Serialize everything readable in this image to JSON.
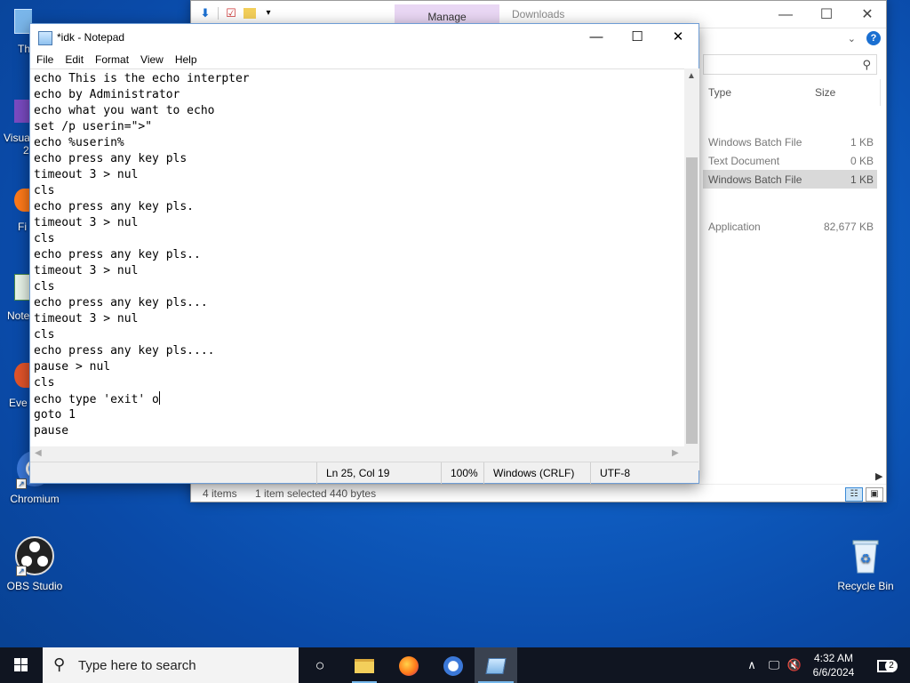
{
  "desktop": {
    "icons": [
      {
        "label": "This PC (partial)",
        "visible_label": "Th"
      },
      {
        "label": "Visual Studio (partial)",
        "visible_label": "Visua"
      },
      {
        "label": "Firefox (partial)",
        "visible_label": "Fi"
      },
      {
        "label": "Notepad (partial)",
        "visible_label": "Note"
      },
      {
        "label": "Everything (partial)",
        "visible_label": "Eve"
      },
      {
        "label": "Chromium",
        "visible_label": "Chromium"
      },
      {
        "label": "OBS Studio",
        "visible_label": "OBS Studio"
      },
      {
        "label": "Recycle Bin",
        "visible_label": "Recycle Bin"
      }
    ],
    "partial_labels": {
      "this_pc": "Th",
      "visual": "Visua",
      "visual_suffix": "2",
      "firefox": "Fi",
      "notepad": "Note",
      "everything": "Eve"
    },
    "chromium_label": "Chromium",
    "obs_label": "OBS Studio",
    "recycle_label": "Recycle Bin"
  },
  "explorer": {
    "ribbon_tab_manage": "Manage",
    "title": "Downloads",
    "help": "?",
    "columns": {
      "type": "Type",
      "size": "Size"
    },
    "rows": [
      {
        "type": "Windows Batch File",
        "size": "1 KB",
        "selected": false
      },
      {
        "type": "Text Document",
        "size": "0 KB",
        "selected": false
      },
      {
        "type": "Windows Batch File",
        "size": "1 KB",
        "selected": true
      },
      {
        "type": "Application",
        "size": "82,677 KB",
        "selected": false
      }
    ],
    "status": {
      "items": "4 items",
      "selected": "1 item selected  440 bytes"
    }
  },
  "notepad": {
    "title": "*idk - Notepad",
    "menu": [
      "File",
      "Edit",
      "Format",
      "View",
      "Help"
    ],
    "lines": [
      "echo This is the echo interpter",
      "echo by Administrator",
      "echo what you want to echo",
      "set /p userin=\">\"",
      "echo %userin%",
      "echo press any key pls",
      "timeout 3 > nul",
      "cls",
      "echo press any key pls.",
      "timeout 3 > nul",
      "cls",
      "echo press any key pls..",
      "timeout 3 > nul",
      "cls",
      "echo press any key pls...",
      "timeout 3 > nul",
      "cls",
      "echo press any key pls....",
      "pause > nul",
      "cls",
      "echo type 'exit' o",
      "goto 1",
      "pause"
    ],
    "caret_line_index": 20,
    "status": {
      "position": "Ln 25, Col 19",
      "zoom": "100%",
      "line_ending": "Windows (CRLF)",
      "encoding": "UTF-8"
    }
  },
  "taskbar": {
    "search_placeholder": "Type here to search",
    "time": "4:32 AM",
    "date": "6/6/2024",
    "notification_count": "2"
  }
}
